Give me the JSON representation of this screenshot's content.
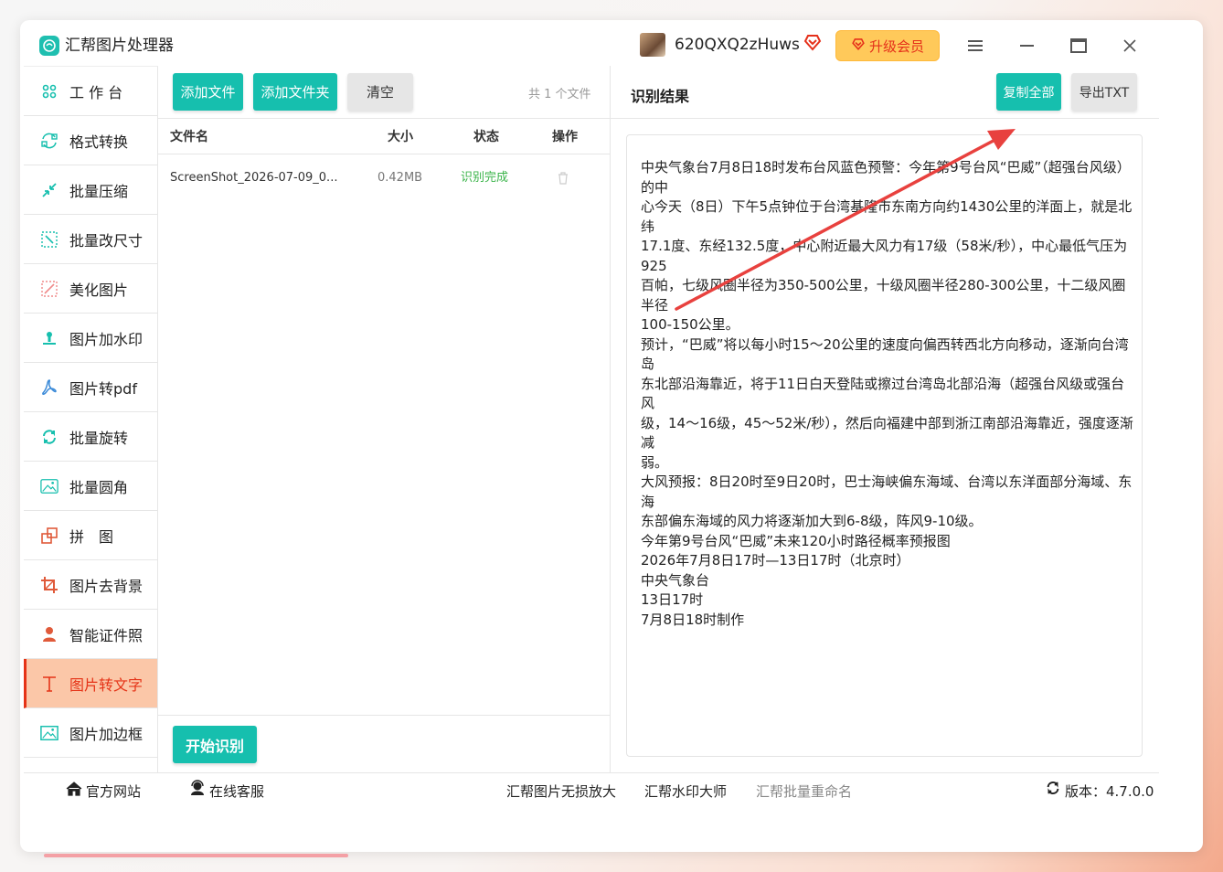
{
  "app": {
    "title": "汇帮图片处理器"
  },
  "user": {
    "name": "620QXQ2zHuws"
  },
  "header": {
    "upgrade_label": "升级会员"
  },
  "sidebar": {
    "items": [
      {
        "label": "工 作 台",
        "icon": "grid-icon",
        "color": "#16bfae"
      },
      {
        "label": "格式转换",
        "icon": "convert-icon",
        "color": "#16bfae"
      },
      {
        "label": "批量压缩",
        "icon": "compress-icon",
        "color": "#16bfae"
      },
      {
        "label": "批量改尺寸",
        "icon": "resize-icon",
        "color": "#16bfae"
      },
      {
        "label": "美化图片",
        "icon": "beautify-icon",
        "color": "#f08a8a"
      },
      {
        "label": "图片加水印",
        "icon": "watermark-icon",
        "color": "#16bfae"
      },
      {
        "label": "图片转pdf",
        "icon": "pdf-icon",
        "color": "#3a8ad8"
      },
      {
        "label": "批量旋转",
        "icon": "rotate-icon",
        "color": "#16bfae"
      },
      {
        "label": "批量圆角",
        "icon": "rounded-corner-icon",
        "color": "#16bfae"
      },
      {
        "label": "拼　图",
        "icon": "puzzle-icon",
        "color": "#e05a3a"
      },
      {
        "label": "图片去背景",
        "icon": "crop-icon",
        "color": "#e05a3a"
      },
      {
        "label": "智能证件照",
        "icon": "person-icon",
        "color": "#e05a3a"
      },
      {
        "label": "图片转文字",
        "icon": "text-icon",
        "color": "#e53317",
        "active": true
      },
      {
        "label": "图片加边框",
        "icon": "frame-icon",
        "color": "#16bfae"
      }
    ]
  },
  "toolbar": {
    "add_file": "添加文件",
    "add_folder": "添加文件夹",
    "clear": "清空",
    "file_count": "共 1 个文件"
  },
  "table": {
    "headers": {
      "name": "文件名",
      "size": "大小",
      "status": "状态",
      "action": "操作"
    },
    "rows": [
      {
        "name": "ScreenShot_2026-07-09_0...",
        "size": "0.42MB",
        "status": "识别完成"
      }
    ]
  },
  "start_button": "开始识别",
  "result": {
    "title": "识别结果",
    "copy_all": "复制全部",
    "export_txt": "导出TXT",
    "text": "中央气象台7月8日18时发布台风蓝色预警：今年第9号台风“巴威”（超强台风级）的中\n心今天（8日）下午5点钟位于台湾基隆市东南方向约1430公里的洋面上，就是北纬\n17.1度、东经132.5度，中心附近最大风力有17级（58米/秒），中心最低气压为925\n百帕，七级风圈半径为350-500公里，十级风圈半径280-300公里，十二级风圈半径\n100-150公里。\n预计，“巴威”将以每小时15～20公里的速度向偏西转西北方向移动，逐渐向台湾岛\n东北部沿海靠近，将于11日白天登陆或擦过台湾岛北部沿海（超强台风级或强台风\n级，14～16级，45～52米/秒），然后向福建中部到浙江南部沿海靠近，强度逐渐减\n弱。\n大风预报：8日20时至9日20时，巴士海峡偏东海域、台湾以东洋面部分海域、东海\n东部偏东海域的风力将逐渐加大到6-8级，阵风9-10级。\n今年第9号台风“巴威”未来120小时路径概率预报图\n2026年7月8日17时—13日17时（北京时）\n中央气象台\n13日17时\n7月8日18时制作"
  },
  "footer": {
    "official_site": "官方网站",
    "online_service": "在线客服",
    "link1": "汇帮图片无损放大",
    "link2": "汇帮水印大师",
    "link3": "汇帮批量重命名",
    "version": "版本：4.7.0.0"
  },
  "colors": {
    "accent": "#16bfae",
    "active_bg": "#fbc7a8",
    "active_text": "#e53317",
    "arrow": "#e8413e"
  }
}
